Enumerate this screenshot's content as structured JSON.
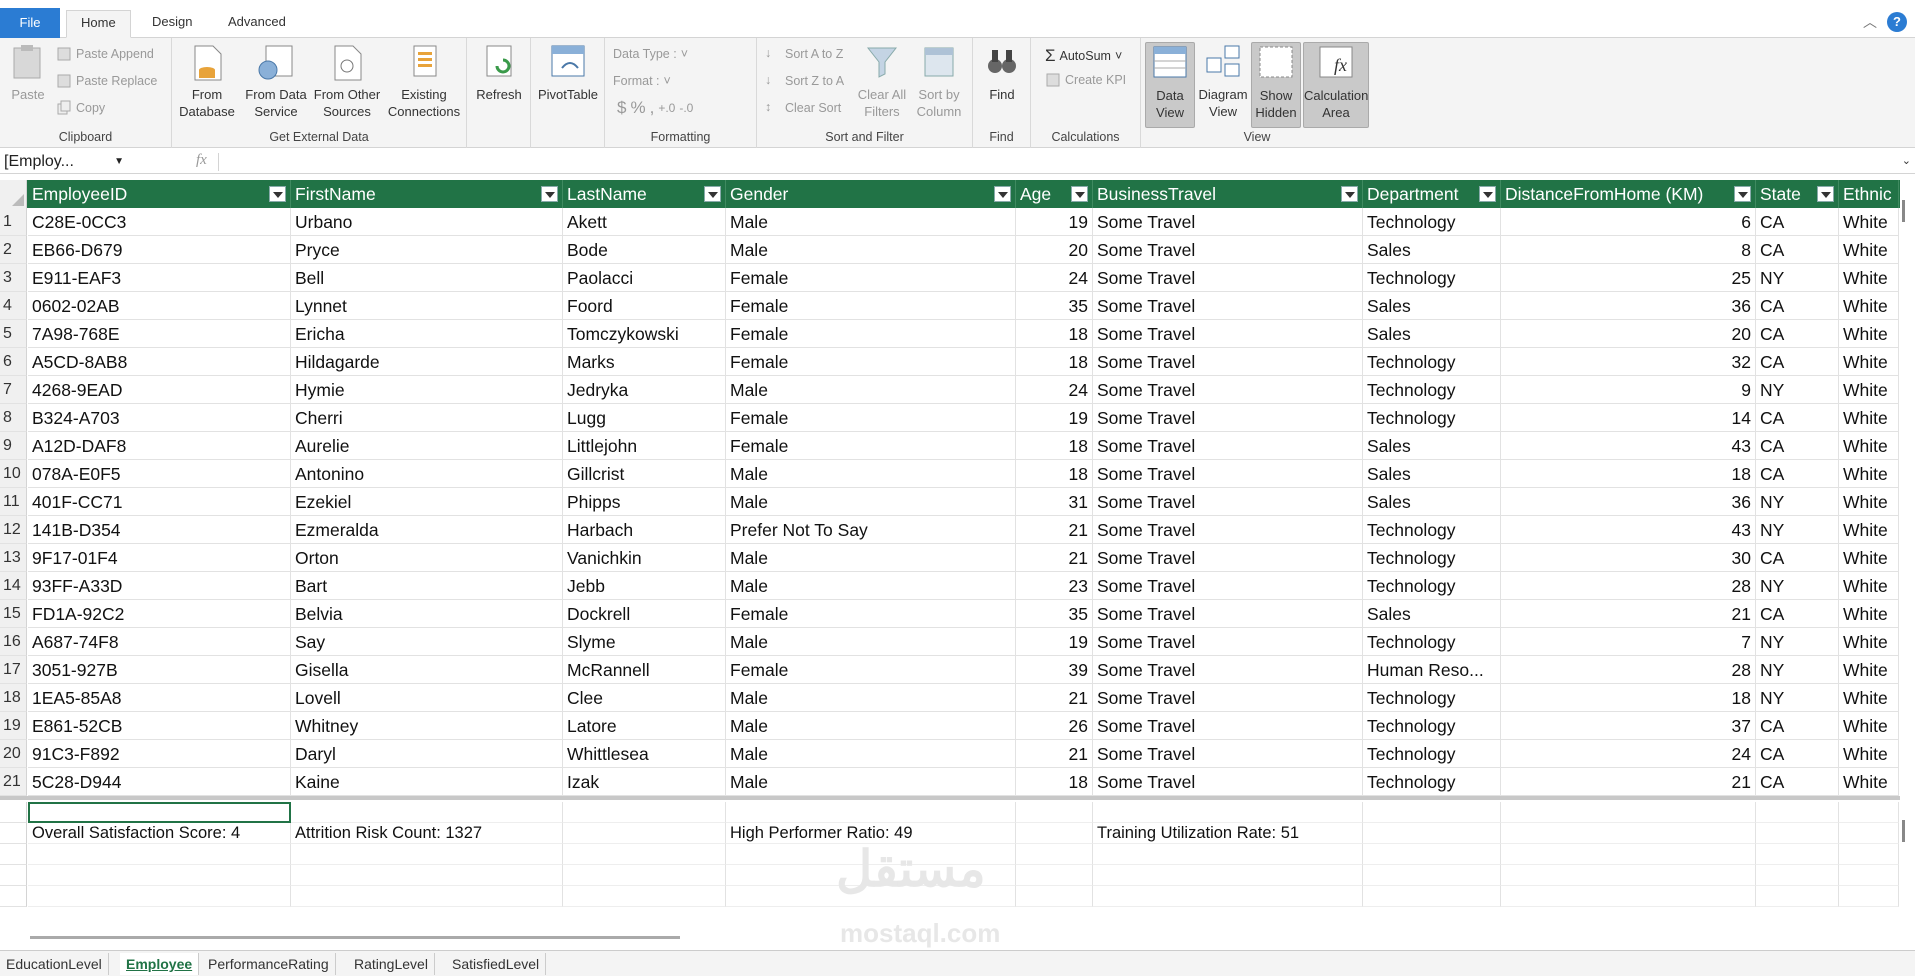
{
  "tabs": {
    "file": "File",
    "home": "Home",
    "design": "Design",
    "advanced": "Advanced"
  },
  "ribbon": {
    "clipboard": {
      "label": "Clipboard",
      "paste": "Paste",
      "paste_append": "Paste Append",
      "paste_replace": "Paste Replace",
      "copy": "Copy"
    },
    "external": {
      "label": "Get External Data",
      "from_db_1": "From",
      "from_db_2": "Database",
      "from_ds_1": "From Data",
      "from_ds_2": "Service",
      "from_other_1": "From Other",
      "from_other_2": "Sources",
      "existing_1": "Existing",
      "existing_2": "Connections"
    },
    "refresh": "Refresh",
    "pivot": "PivotTable",
    "formatting": {
      "label": "Formatting",
      "data_type": "Data Type :",
      "format": "Format :",
      "currency": "$",
      "percent": "%"
    },
    "sort": {
      "label": "Sort and Filter",
      "az": "Sort A to Z",
      "za": "Sort Z to A",
      "clear_sort": "Clear Sort",
      "clear_filters_1": "Clear All",
      "clear_filters_2": "Filters",
      "sort_col_1": "Sort by",
      "sort_col_2": "Column"
    },
    "find": {
      "label": "Find",
      "btn": "Find"
    },
    "calculations": {
      "label": "Calculations",
      "autosum": "AutoSum",
      "kpi": "Create KPI"
    },
    "view": {
      "label": "View",
      "data_1": "Data",
      "data_2": "View",
      "diagram_1": "Diagram",
      "diagram_2": "View",
      "hidden_1": "Show",
      "hidden_2": "Hidden",
      "calc_1": "Calculation",
      "calc_2": "Area"
    }
  },
  "formula_bar": {
    "name_box": "[Employ...",
    "fx": "fx"
  },
  "columns": [
    "EmployeeID",
    "FirstName",
    "LastName",
    "Gender",
    "Age",
    "BusinessTravel",
    "Department",
    "DistanceFromHome (KM)",
    "State",
    "Ethnic"
  ],
  "rows": [
    [
      "C28E-0CC3",
      "Urbano",
      "Akett",
      "Male",
      "19",
      "Some Travel",
      "Technology",
      "6",
      "CA",
      "White"
    ],
    [
      "EB66-D679",
      "Pryce",
      "Bode",
      "Male",
      "20",
      "Some Travel",
      "Sales",
      "8",
      "CA",
      "White"
    ],
    [
      "E911-EAF3",
      "Bell",
      "Paolacci",
      "Female",
      "24",
      "Some Travel",
      "Technology",
      "25",
      "NY",
      "White"
    ],
    [
      "0602-02AB",
      "Lynnet",
      "Foord",
      "Female",
      "35",
      "Some Travel",
      "Sales",
      "36",
      "CA",
      "White"
    ],
    [
      "7A98-768E",
      "Ericha",
      "Tomczykowski",
      "Female",
      "18",
      "Some Travel",
      "Sales",
      "20",
      "CA",
      "White"
    ],
    [
      "A5CD-8AB8",
      "Hildagarde",
      "Marks",
      "Female",
      "18",
      "Some Travel",
      "Technology",
      "32",
      "CA",
      "White"
    ],
    [
      "4268-9EAD",
      "Hymie",
      "Jedryka",
      "Male",
      "24",
      "Some Travel",
      "Technology",
      "9",
      "NY",
      "White"
    ],
    [
      "B324-A703",
      "Cherri",
      "Lugg",
      "Female",
      "19",
      "Some Travel",
      "Technology",
      "14",
      "CA",
      "White"
    ],
    [
      "A12D-DAF8",
      "Aurelie",
      "Littlejohn",
      "Female",
      "18",
      "Some Travel",
      "Sales",
      "43",
      "CA",
      "White"
    ],
    [
      "078A-E0F5",
      "Antonino",
      "Gillcrist",
      "Male",
      "18",
      "Some Travel",
      "Sales",
      "18",
      "CA",
      "White"
    ],
    [
      "401F-CC71",
      "Ezekiel",
      "Phipps",
      "Male",
      "31",
      "Some Travel",
      "Sales",
      "36",
      "NY",
      "White"
    ],
    [
      "141B-D354",
      "Ezmeralda",
      "Harbach",
      "Prefer Not To Say",
      "21",
      "Some Travel",
      "Technology",
      "43",
      "NY",
      "White"
    ],
    [
      "9F17-01F4",
      "Orton",
      "Vanichkin",
      "Male",
      "21",
      "Some Travel",
      "Technology",
      "30",
      "CA",
      "White"
    ],
    [
      "93FF-A33D",
      "Bart",
      "Jebb",
      "Male",
      "23",
      "Some Travel",
      "Technology",
      "28",
      "NY",
      "White"
    ],
    [
      "FD1A-92C2",
      "Belvia",
      "Dockrell",
      "Female",
      "35",
      "Some Travel",
      "Sales",
      "21",
      "CA",
      "White"
    ],
    [
      "A687-74F8",
      "Say",
      "Slyme",
      "Male",
      "19",
      "Some Travel",
      "Technology",
      "7",
      "NY",
      "White"
    ],
    [
      "3051-927B",
      "Gisella",
      "McRannell",
      "Female",
      "39",
      "Some Travel",
      "Human Reso...",
      "28",
      "NY",
      "White"
    ],
    [
      "1EA5-85A8",
      "Lovell",
      "Clee",
      "Male",
      "21",
      "Some Travel",
      "Technology",
      "18",
      "NY",
      "White"
    ],
    [
      "E861-52CB",
      "Whitney",
      "Latore",
      "Male",
      "26",
      "Some Travel",
      "Technology",
      "37",
      "CA",
      "White"
    ],
    [
      "91C3-F892",
      "Daryl",
      "Whittlesea",
      "Male",
      "21",
      "Some Travel",
      "Technology",
      "24",
      "CA",
      "White"
    ],
    [
      "5C28-D944",
      "Kaine",
      "Izak",
      "Male",
      "18",
      "Some Travel",
      "Technology",
      "21",
      "CA",
      "White"
    ]
  ],
  "measures": {
    "m1": "Overall Satisfaction Score: 4",
    "m2": "Attrition Risk Count: 1327",
    "m3": "High Performer Ratio: 49",
    "m4": "Training Utilization Rate: 51"
  },
  "sheets": [
    "EducationLevel",
    "Employee",
    "PerformanceRating",
    "RatingLevel",
    "SatisfiedLevel"
  ],
  "active_sheet": "Employee",
  "watermark": {
    "arabic": "مستقل",
    "latin": "mostaql.com"
  },
  "colors": {
    "header_green": "#217346",
    "file_blue": "#2b7cd3"
  }
}
